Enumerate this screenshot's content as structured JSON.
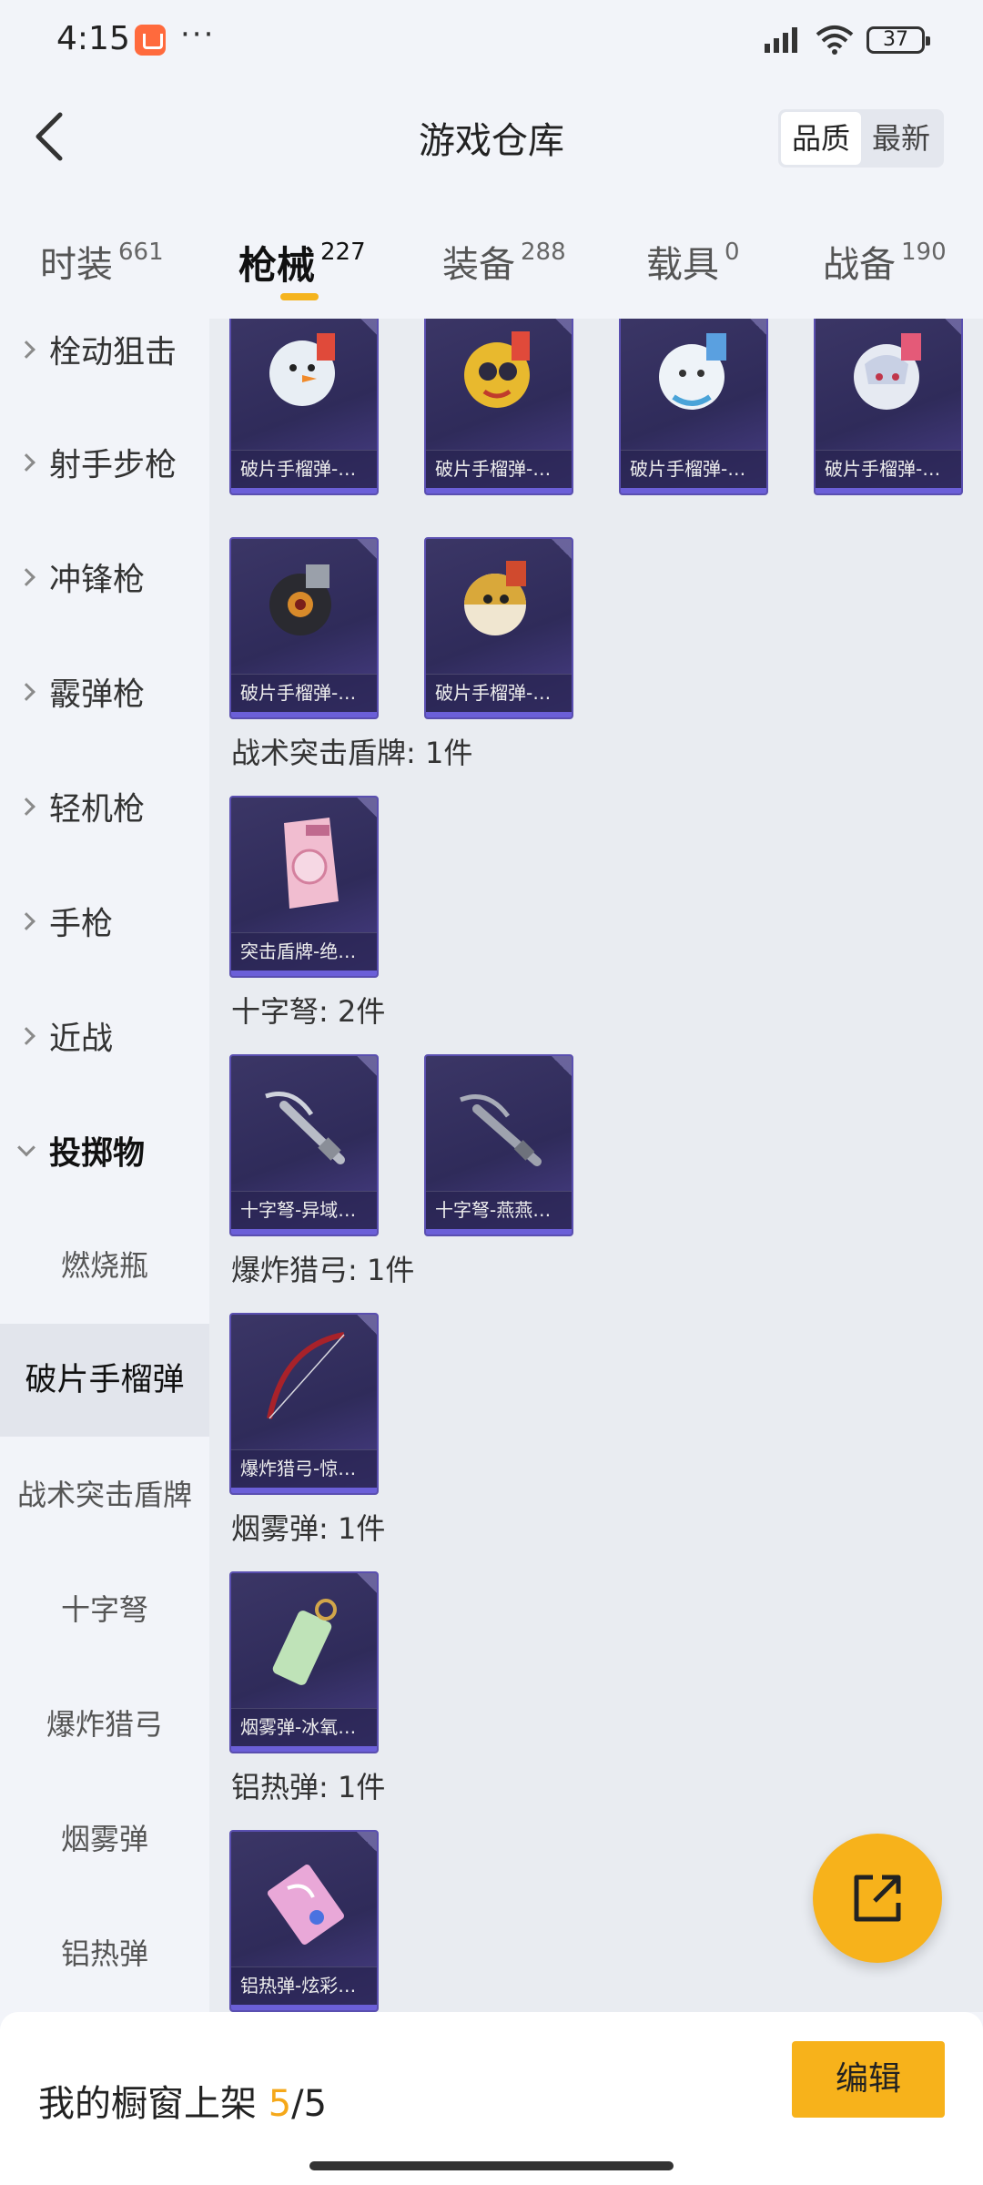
{
  "status": {
    "time": "4:15",
    "battery": "37"
  },
  "header": {
    "title": "游戏仓库",
    "sort": [
      "品质",
      "最新"
    ]
  },
  "tabs": [
    {
      "label": "时装",
      "count": "661"
    },
    {
      "label": "枪械",
      "count": "227"
    },
    {
      "label": "装备",
      "count": "288"
    },
    {
      "label": "载具",
      "count": "0"
    },
    {
      "label": "战备",
      "count": "190"
    }
  ],
  "sidebar": {
    "categories": [
      "栓动狙击",
      "射手步枪",
      "冲锋枪",
      "霰弹枪",
      "轻机枪",
      "手枪",
      "近战",
      "投掷物"
    ],
    "subcategories": [
      "燃烧瓶",
      "破片手榴弹",
      "战术突击盾牌",
      "十字弩",
      "爆炸猎弓",
      "烟雾弹",
      "铝热弹"
    ]
  },
  "grid": {
    "frag_row1": [
      "破片手榴弹-…",
      "破片手榴弹-…",
      "破片手榴弹-…",
      "破片手榴弹-…"
    ],
    "frag_row2": [
      "破片手榴弹-…",
      "破片手榴弹-…"
    ],
    "shield_title": "战术突击盾牌: 1件",
    "shield": [
      "突击盾牌-绝…"
    ],
    "crossbow_title": "十字弩: 2件",
    "crossbow": [
      "十字弩-异域…",
      "十字弩-燕燕…"
    ],
    "bow_title": "爆炸猎弓: 1件",
    "bow": [
      "爆炸猎弓-惊…"
    ],
    "smoke_title": "烟雾弹: 1件",
    "smoke": [
      "烟雾弹-冰氧…"
    ],
    "thermite_title": "铝热弹: 1件",
    "thermite": [
      "铝热弹-炫彩…"
    ]
  },
  "bottom": {
    "showcase_label": "我的橱窗上架",
    "showcase_used": "5",
    "showcase_total": "/5",
    "edit": "编辑"
  }
}
